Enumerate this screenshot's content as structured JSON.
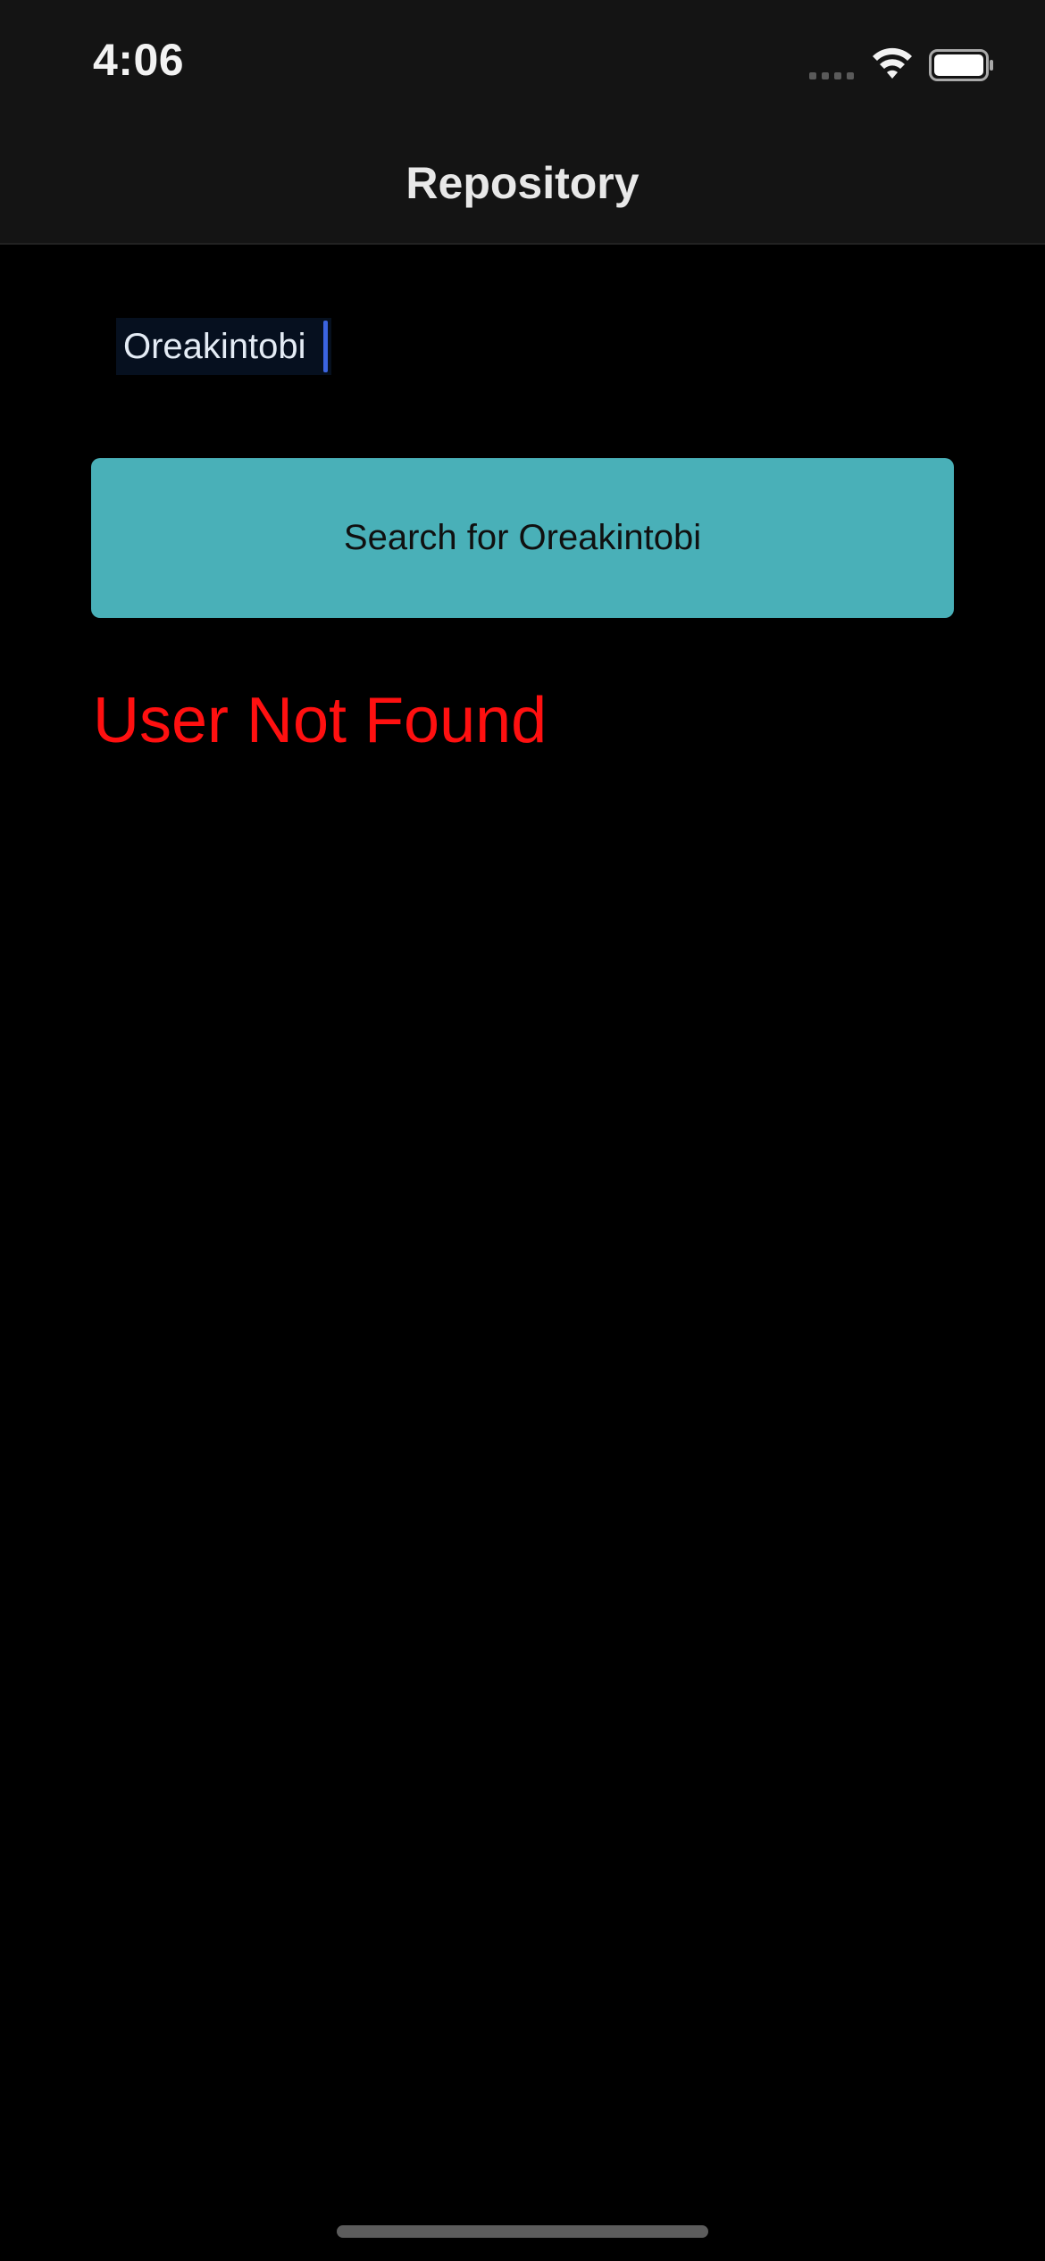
{
  "status_bar": {
    "time": "4:06",
    "icons": [
      "signal-dots-icon",
      "wifi-icon",
      "battery-icon"
    ]
  },
  "nav": {
    "title": "Repository"
  },
  "search": {
    "value": "Oreakintobi",
    "button_label": "Search for Oreakintobi"
  },
  "result": {
    "error_message": "User Not Found"
  },
  "colors": {
    "background": "#000000",
    "top_bar": "#141414",
    "button": "#49b0b8",
    "error": "#ff1010",
    "caret": "#3b64e0"
  }
}
